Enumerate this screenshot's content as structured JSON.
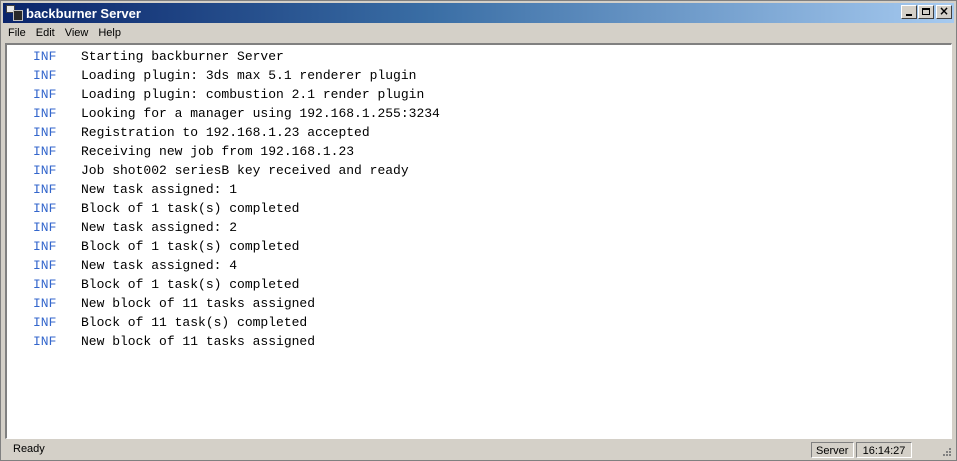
{
  "window": {
    "title": "backburner Server",
    "buttons": [
      "minimize",
      "maximize",
      "close"
    ]
  },
  "menu": {
    "items": [
      "File",
      "Edit",
      "View",
      "Help"
    ]
  },
  "log": [
    {
      "level": "INF",
      "message": "Starting backburner Server"
    },
    {
      "level": "INF",
      "message": "Loading plugin: 3ds max 5.1 renderer plugin"
    },
    {
      "level": "INF",
      "message": "Loading plugin: combustion 2.1 render plugin"
    },
    {
      "level": "INF",
      "message": "Looking for a manager using 192.168.1.255:3234"
    },
    {
      "level": "INF",
      "message": "Registration to 192.168.1.23 accepted"
    },
    {
      "level": "INF",
      "message": "Receiving new job from 192.168.1.23"
    },
    {
      "level": "INF",
      "message": "Job shot002 seriesB key received and ready"
    },
    {
      "level": "INF",
      "message": "New task assigned: 1"
    },
    {
      "level": "INF",
      "message": "Block of 1 task(s) completed"
    },
    {
      "level": "INF",
      "message": "New task assigned: 2"
    },
    {
      "level": "INF",
      "message": "Block of 1 task(s) completed"
    },
    {
      "level": "INF",
      "message": "New task assigned: 4"
    },
    {
      "level": "INF",
      "message": "Block of 1 task(s) completed"
    },
    {
      "level": "INF",
      "message": "New block of 11 tasks assigned"
    },
    {
      "level": "INF",
      "message": "Block of 11 task(s) completed"
    },
    {
      "level": "INF",
      "message": "New block of 11 tasks assigned"
    }
  ],
  "status": {
    "text": "Ready",
    "role": "Server",
    "time": "16:14:27"
  },
  "colors": {
    "title_gradient_start": "#0a246a",
    "title_gradient_end": "#a6caf0",
    "log_level": "#3366cc",
    "chrome": "#d4d0c8"
  }
}
